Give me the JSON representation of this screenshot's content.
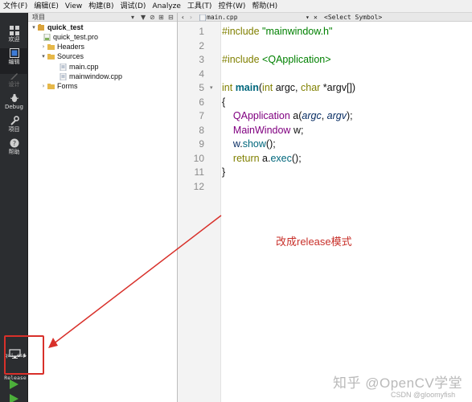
{
  "menu": [
    "文件(F)",
    "编辑(E)",
    "View",
    "构建(B)",
    "调试(D)",
    "Analyze",
    "工具(T)",
    "控件(W)",
    "帮助(H)"
  ],
  "modes": [
    {
      "label": "欢迎",
      "icon": "grid-icon"
    },
    {
      "label": "编辑",
      "icon": "edit-icon"
    },
    {
      "label": "设计",
      "icon": "design-icon"
    },
    {
      "label": "Debug",
      "icon": "bug-icon"
    },
    {
      "label": "项目",
      "icon": "wrench-icon"
    },
    {
      "label": "帮助",
      "icon": "help-icon"
    }
  ],
  "project_panel": {
    "title": "项目",
    "tree": [
      {
        "label": "quick_test",
        "bold": true
      },
      {
        "label": "quick_test.pro"
      },
      {
        "label": "Headers"
      },
      {
        "label": "Sources"
      },
      {
        "label": "main.cpp"
      },
      {
        "label": "mainwindow.cpp"
      },
      {
        "label": "Forms"
      }
    ]
  },
  "editor": {
    "file": "main.cpp",
    "symbol": "<Select Symbol>",
    "line_numbers": [
      "1",
      "2",
      "3",
      "4",
      "5",
      "6",
      "7",
      "8",
      "9",
      "10",
      "11",
      "12"
    ]
  },
  "code": {
    "l1_a": "#include ",
    "l1_b": "\"mainwindow.h\"",
    "l3_a": "#include ",
    "l3_b": "<QApplication>",
    "l5_a": "int",
    "l5_b": " ",
    "l5_c": "main",
    "l5_d": "(",
    "l5_e": "int",
    "l5_f": " argc, ",
    "l5_g": "char",
    "l5_h": " *argv[])",
    "l6": "{",
    "l7_a": "    ",
    "l7_b": "QApplication",
    "l7_c": " a(",
    "l7_d": "argc",
    "l7_e": ", ",
    "l7_f": "argv",
    "l7_g": ");",
    "l8_a": "    ",
    "l8_b": "MainWindow",
    "l8_c": " w;",
    "l9_a": "    ",
    "l9_b": "w",
    "l9_c": ".",
    "l9_d": "show",
    "l9_e": "();",
    "l10_a": "    ",
    "l10_b": "return",
    "l10_c": " a.",
    "l10_d": "exec",
    "l10_e": "();",
    "l11": "}"
  },
  "annotation": "改成release模式",
  "kit": {
    "project": "qui…est",
    "build": "Release"
  },
  "watermark": {
    "logo": "知乎 @OpenCV学堂",
    "sub": "CSDN @gloomyfish"
  },
  "colors": {
    "annotation": "#c8302a",
    "sidebar": "#2b2d30",
    "run_green": "#4caf3a"
  }
}
